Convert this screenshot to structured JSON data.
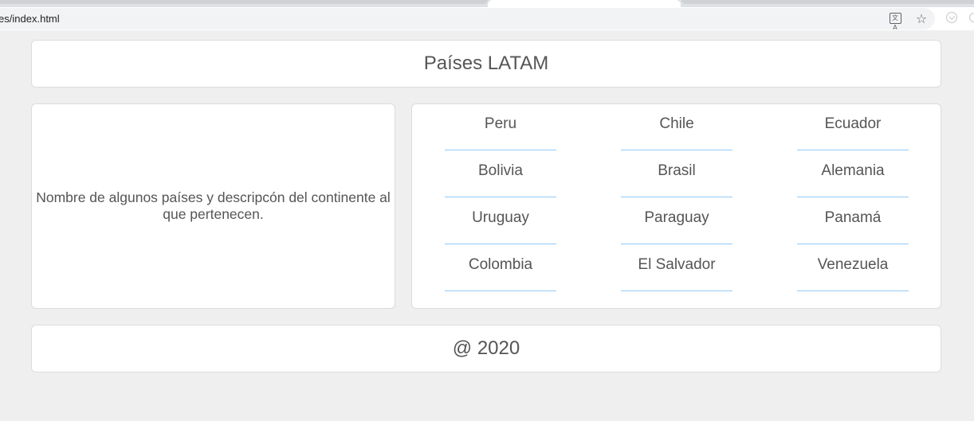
{
  "browser": {
    "url": "ntries/index.html",
    "icons": {
      "translate": "translate-icon",
      "bookmark": "star-icon",
      "extension": "extension-icon"
    }
  },
  "header": {
    "title": "Países LATAM"
  },
  "description": {
    "text": "Nombre de algunos países y descripcón del continente al que pertenecen."
  },
  "countries": [
    [
      "Peru",
      "Chile",
      "Ecuador"
    ],
    [
      "Bolivia",
      "Brasil",
      "Alemania"
    ],
    [
      "Uruguay",
      "Paraguay",
      "Panamá"
    ],
    [
      "Colombia",
      "El Salvador",
      "Venezuela"
    ]
  ],
  "footer": {
    "text": "@ 2020"
  },
  "colors": {
    "background": "#efefef",
    "card": "#ffffff",
    "underline": "#90caf9",
    "text": "#555555"
  }
}
